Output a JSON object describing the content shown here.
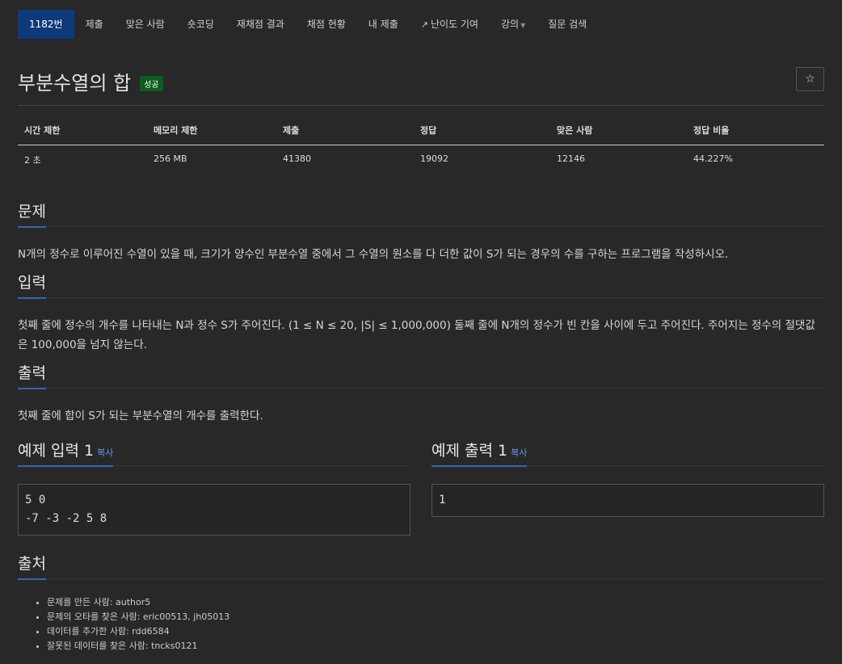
{
  "nav": {
    "items": [
      {
        "label": "1182번"
      },
      {
        "label": "제출"
      },
      {
        "label": "맞은 사람"
      },
      {
        "label": "숏코딩"
      },
      {
        "label": "재채점 결과"
      },
      {
        "label": "채점 현황"
      },
      {
        "label": "내 제출"
      },
      {
        "label": "난이도 기여",
        "icon": "external-link-icon"
      },
      {
        "label": "강의",
        "icon": "caret-down-icon"
      },
      {
        "label": "질문 검색"
      }
    ]
  },
  "problem": {
    "title": "부분수열의 합",
    "badge": "성공",
    "star_glyph": "☆"
  },
  "info_table": {
    "headers": [
      "시간 제한",
      "메모리 제한",
      "제출",
      "정답",
      "맞은 사람",
      "정답 비율"
    ],
    "values": [
      "2 초",
      "256 MB",
      "41380",
      "19092",
      "12146",
      "44.227%"
    ]
  },
  "sections": {
    "problem_heading": "문제",
    "problem_text": "N개의 정수로 이루어진 수열이 있을 때, 크기가 양수인 부분수열 중에서 그 수열의 원소를 다 더한 값이 S가 되는 경우의 수를 구하는 프로그램을 작성하시오.",
    "input_heading": "입력",
    "input_text": "첫째 줄에 정수의 개수를 나타내는 N과 정수 S가 주어진다. (1 ≤ N ≤ 20, |S| ≤ 1,000,000) 둘째 줄에 N개의 정수가 빈 칸을 사이에 두고 주어진다. 주어지는 정수의 절댓값은 100,000을 넘지 않는다.",
    "output_heading": "출력",
    "output_text": "첫째 줄에 합이 S가 되는 부분수열의 개수를 출력한다."
  },
  "examples": {
    "input_heading": "예제 입력 1",
    "output_heading": "예제 출력 1",
    "copy_label": "복사",
    "input_value": "5 0\n-7 -3 -2 5 8",
    "output_value": "1"
  },
  "source": {
    "heading": "출처",
    "items": [
      "문제를 만든 사람: author5",
      "문제의 오타를 찾은 사람: eric00513, jh05013",
      "데이터를 추가한 사람: rdd6584",
      "잘못된 데이터를 찾은 사람: tncks0121"
    ]
  },
  "colors": {
    "background": "#282828",
    "nav_active": "#0d3a7a",
    "accent_underline": "#2e66b5",
    "badge_green": "#0b5d1e",
    "link": "#5c9ef0"
  }
}
